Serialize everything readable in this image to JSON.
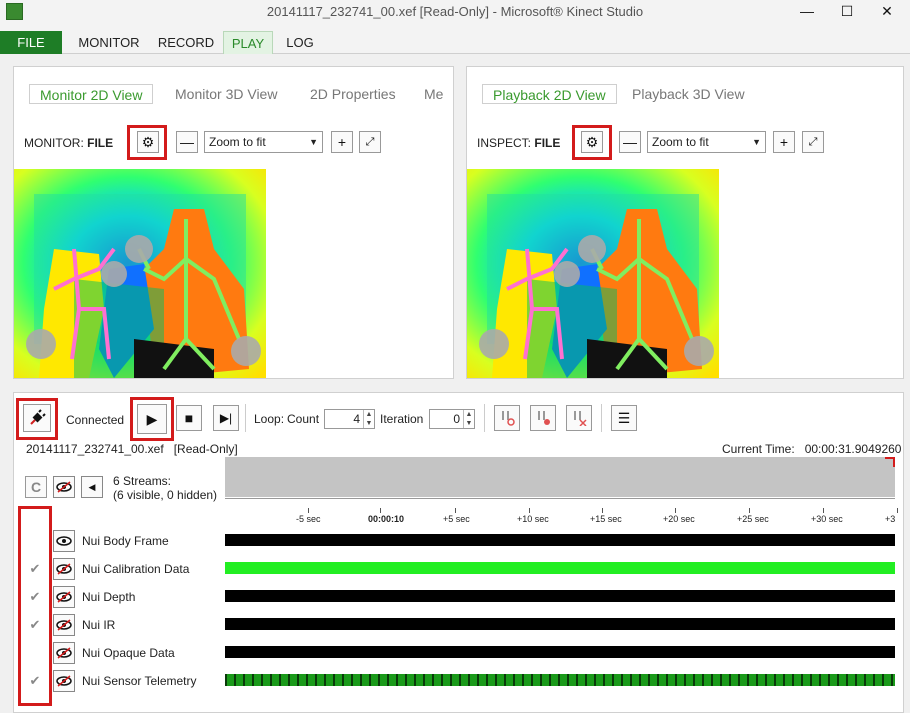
{
  "window": {
    "title": "20141117_232741_00.xef [Read-Only] - Microsoft® Kinect Studio",
    "minimize": "—",
    "maximize": "☐",
    "close": "✕"
  },
  "menu": [
    "FILE",
    "MONITOR",
    "RECORD",
    "PLAY",
    "LOG"
  ],
  "monitor_panel": {
    "tabs": [
      "Monitor 2D View",
      "Monitor 3D View",
      "2D Properties",
      "Me"
    ],
    "source_label": "MONITOR:",
    "source_value": "FILE",
    "zoom": "Zoom to fit"
  },
  "playback_panel": {
    "tabs": [
      "Playback 2D View",
      "Playback 3D View"
    ],
    "source_label": "INSPECT:",
    "source_value": "FILE",
    "zoom": "Zoom to fit"
  },
  "controls": {
    "connected": "Connected",
    "loop_label": "Loop:",
    "count_label": "Count",
    "count_value": "4",
    "iteration_label": "Iteration",
    "iteration_value": "0"
  },
  "file": {
    "name": "20141117_232741_00.xef",
    "mode": "[Read-Only]"
  },
  "current_time": {
    "label": "Current Time:",
    "value": "00:00:31.9049260"
  },
  "streams": {
    "summary_line1": "6 Streams:",
    "summary_line2": "(6 visible, 0 hidden)",
    "c_button": "C",
    "items": [
      {
        "name": "Nui Body Frame",
        "checked": false,
        "color": "#000000"
      },
      {
        "name": "Nui Calibration Data",
        "checked": true,
        "color": "#22ee22"
      },
      {
        "name": "Nui Depth",
        "checked": true,
        "color": "#000000"
      },
      {
        "name": "Nui IR",
        "checked": true,
        "color": "#000000"
      },
      {
        "name": "Nui Opaque Data",
        "checked": false,
        "color": "#000000"
      },
      {
        "name": "Nui Sensor Telemetry",
        "checked": true,
        "color": "#1a9a1a"
      }
    ]
  },
  "timeline": {
    "ticks": [
      "-5 sec",
      "00:00:10",
      "+5 sec",
      "+10 sec",
      "+15 sec",
      "+20 sec",
      "+25 sec",
      "+30 sec",
      "+3"
    ]
  },
  "colors": {
    "accent": "#1e7d26",
    "highlight": "#d31b1b"
  }
}
